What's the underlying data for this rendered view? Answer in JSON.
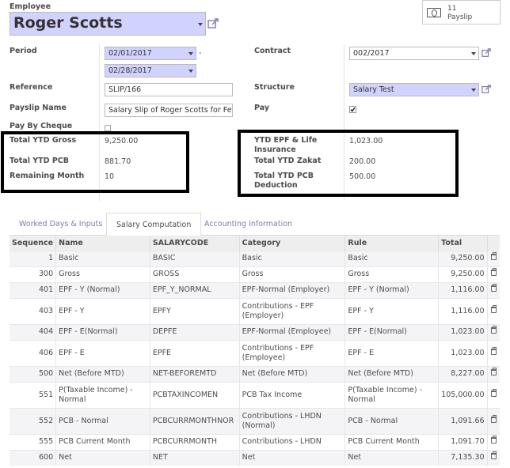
{
  "employee": {
    "label": "Employee",
    "value": "Roger Scotts"
  },
  "smart_button": {
    "count": "11",
    "label": "Payslip"
  },
  "form": {
    "period_label": "Period",
    "date_from": "02/01/2017",
    "date_sep": "-",
    "date_to": "02/28/2017",
    "contract_label": "Contract",
    "contract_value": "002/2017",
    "reference_label": "Reference",
    "reference_value": "SLIP/166",
    "structure_label": "Structure",
    "structure_value": "Salary Test",
    "payslip_name_label": "Payslip Name",
    "payslip_name_value": "Salary Slip of Roger Scotts for Febr",
    "pay_label": "Pay",
    "pay_checked": true,
    "pay_by_cheque_label": "Pay By Cheque",
    "pay_by_cheque_checked": false,
    "ytd_gross_label": "Total YTD Gross",
    "ytd_gross_value": "9,250.00",
    "ytd_pcb_label": "Total YTD PCB",
    "ytd_pcb_value": "881.70",
    "remaining_month_label": "Remaining Month",
    "remaining_month_value": "10",
    "ytd_epf_label": "YTD EPF & Life Insurance",
    "ytd_epf_value": "1,023.00",
    "ytd_zakat_label": "Total YTD Zakat",
    "ytd_zakat_value": "200.00",
    "ytd_pcb_deduction_label": "Total YTD PCB Deduction",
    "ytd_pcb_deduction_value": "500.00"
  },
  "tabs": [
    {
      "label": "Worked Days & Inputs",
      "active": false
    },
    {
      "label": "Salary Computation",
      "active": true
    },
    {
      "label": "Accounting Information",
      "active": false
    }
  ],
  "table": {
    "headers": [
      "Sequence",
      "Name",
      "SALARYCODE",
      "Category",
      "Rule",
      "Total"
    ],
    "rows": [
      {
        "seq": "1",
        "name": "Basic",
        "code": "BASIC",
        "category": "Basic",
        "rule": "Basic",
        "total": "9,250.00"
      },
      {
        "seq": "300",
        "name": "Gross",
        "code": "GROSS",
        "category": "Gross",
        "rule": "Gross",
        "total": "9,250.00"
      },
      {
        "seq": "401",
        "name": "EPF - Y (Normal)",
        "code": "EPF_Y_NORMAL",
        "category": "EPF-Normal (Employer)",
        "rule": "EPF - Y (Normal)",
        "total": "1,116.00"
      },
      {
        "seq": "403",
        "name": "EPF - Y",
        "code": "EPFY",
        "category": "Contributions - EPF (Employer)",
        "rule": "EPF - Y",
        "total": "1,116.00"
      },
      {
        "seq": "404",
        "name": "EPF - E(Normal)",
        "code": "DEPFE",
        "category": "EPF-Normal (Employee)",
        "rule": "EPF - E(Normal)",
        "total": "1,023.00"
      },
      {
        "seq": "406",
        "name": "EPF - E",
        "code": "EPFE",
        "category": "Contributions - EPF (Employee)",
        "rule": "EPF - E",
        "total": "1,023.00"
      },
      {
        "seq": "500",
        "name": "Net (Before MTD)",
        "code": "NET-BEFOREMTD",
        "category": "Net (Before MTD)",
        "rule": "Net (Before MTD)",
        "total": "8,227.00"
      },
      {
        "seq": "551",
        "name": "P(Taxable Income) - Normal",
        "code": "PCBTAXINCOMEN",
        "category": "PCB Tax Income",
        "rule": "P(Taxable Income) - Normal",
        "total": "105,000.00"
      },
      {
        "seq": "552",
        "name": "PCB - Normal",
        "code": "PCBCURRMONTHNOR",
        "category": "Contributions - LHDN (Normal)",
        "rule": "PCB - Normal",
        "total": "1,091.66"
      },
      {
        "seq": "555",
        "name": "PCB Current Month",
        "code": "PCBCURRMONTH",
        "category": "Contributions - LHDN",
        "rule": "PCB Current Month",
        "total": "1,091.70"
      },
      {
        "seq": "600",
        "name": "Net",
        "code": "NET",
        "category": "Net",
        "rule": "Net",
        "total": "7,135.30"
      }
    ]
  }
}
